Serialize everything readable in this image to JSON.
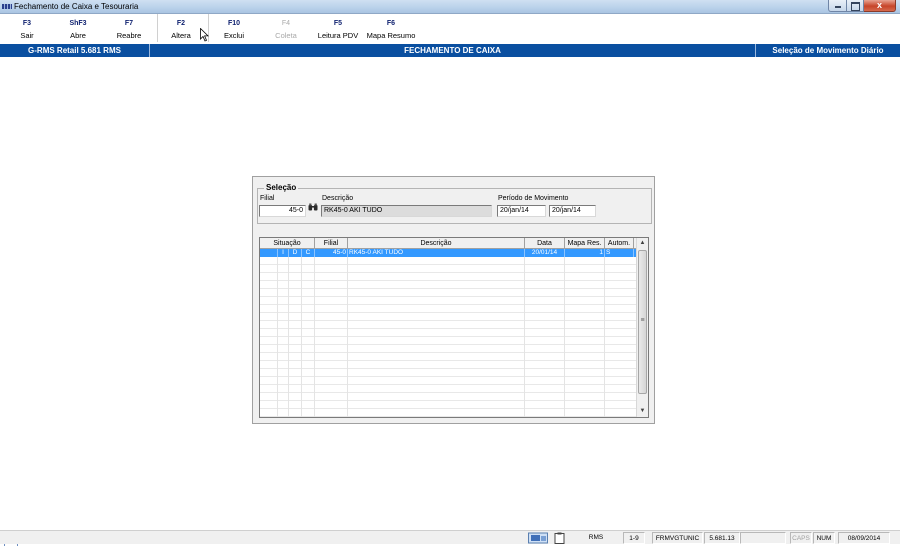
{
  "window": {
    "title": "Fechamento de Caixa e Tesouraria",
    "close_glyph": "x"
  },
  "toolbar": {
    "buttons": [
      {
        "key": "F3",
        "label": "Sair"
      },
      {
        "key": "ShF3",
        "label": "Abre"
      },
      {
        "key": "F7",
        "label": "Reabre"
      },
      {
        "key": "F2",
        "label": "Altera"
      },
      {
        "key": "F10",
        "label": "Exclui"
      },
      {
        "key": "F4",
        "label": "Coleta",
        "disabled": true
      },
      {
        "key": "F5",
        "label": "Leitura PDV"
      },
      {
        "key": "F6",
        "label": "Mapa Resumo"
      }
    ]
  },
  "header": {
    "left": "G-RMS Retail 5.681 RMS",
    "center": "FECHAMENTO DE CAIXA",
    "right": "Seleção de Movimento Diário"
  },
  "selection": {
    "legend": "Seleção",
    "filial_label": "Filial",
    "filial_value": "45-0",
    "descricao_label": "Descrição",
    "descricao_value": "RK45-0 AKI TUDO",
    "periodo_label": "Período de Movimento",
    "periodo_inicio": "20/jan/14",
    "periodo_fim": "20/jan/14"
  },
  "grid": {
    "columns": [
      "Situação",
      "Filial",
      "Descrição",
      "Data",
      "Mapa Res.",
      "Autom."
    ],
    "rows": [
      {
        "s1": "I",
        "s2": "D",
        "s3": "C",
        "filial": "45-0",
        "descricao": "RK45-0 AKI TUDO",
        "data": "20/01/14",
        "mapa": "1",
        "autom": "S",
        "selected": true
      }
    ]
  },
  "statusbar": {
    "user": "RMS",
    "page": "1-9",
    "program": "FRMVGTUNIC",
    "version": "5.681.13",
    "caps": "CAPS",
    "num": "NUM",
    "date": "08/09/2014"
  },
  "colors": {
    "header_bg": "#0a4fa0",
    "selection_bg": "#3399ff",
    "toolbar_key": "#0d1f6e"
  },
  "icons": [
    "app-icon",
    "binoculars-icon",
    "network-icon",
    "clipboard-icon",
    "mouse-cursor-icon",
    "scroll-up-icon",
    "scroll-down-icon"
  ]
}
